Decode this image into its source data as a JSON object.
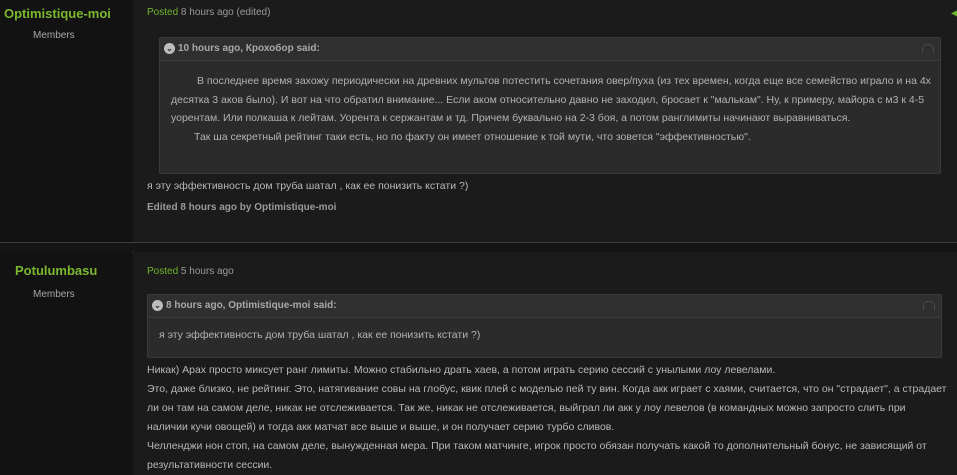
{
  "posts": [
    {
      "author": "Optimistique-moi",
      "group": "Members",
      "posted_label": "Posted",
      "posted_time": "8 hours ago",
      "edited_tag": "(edited)",
      "quote": {
        "header": "10 hours ago, Крохобор said:",
        "lines": [
          "В последнее время захожу периодически на древних мультов потестить сочетания овер/пуха (из тех времен, когда еще все семейство играло и на 4х десятка 3 аков было). И вот на что обратил внимание... Если аком относительно давно не заходил, бросает к \"малькам\". Ну, к примеру, майора с м3 к 4-5 уорентам. Или полкаша к лейтам. Уорента к сержантам и тд. Причем буквально на 2-3 боя, а потом ранглимиты начинают выравниваться.",
          "Так ша секретный рейтинг таки есть, но по факту он имеет отношение к той мути, что зовется \"эффективностью\"."
        ]
      },
      "body": [
        "я эту эффективность дом труба шатал   , как ее понизить кстати ?)"
      ],
      "edited_line": "Edited 8 hours ago by Optimistique-moi"
    },
    {
      "author": "Potulumbasu",
      "group": "Members",
      "posted_label": "Posted",
      "posted_time": "5 hours ago",
      "quote": {
        "header": "8 hours ago, Optimistique-moi said:",
        "lines": [
          "я эту эффективность дом труба шатал   , как ее понизить кстати ?)"
        ]
      },
      "body": [
        "Никак) Арах просто миксует ранг лимиты. Можно стабильно драть хаев, а потом играть серию сессий с унылыми лоу левелами.",
        "Это, даже близко, не рейтинг. Это, натягивание совы на глобус, квик плей с моделью пей ту вин. Когда акк играет с хаями, считается, что он \"страдает\", а страдает ли он там на самом деле, никак не отслеживается. Так же, никак не отслеживается, выйграл ли акк у лоу левелов (в командных можно запросто слить при наличии кучи овощей) и тогда акк матчат все выше и выше, и он получает серию турбо сливов.",
        "Челленджи нон стоп, на самом деле, вынужденная мера. При таком матчинге, игрок просто обязан получать какой то дополнительный бонус, не зависящий от результативности сессии."
      ]
    }
  ],
  "colors": {
    "author": "#7bb82f",
    "posted": "#6fb52c",
    "background": "#151515",
    "quote_bg": "#2b2b2b"
  }
}
